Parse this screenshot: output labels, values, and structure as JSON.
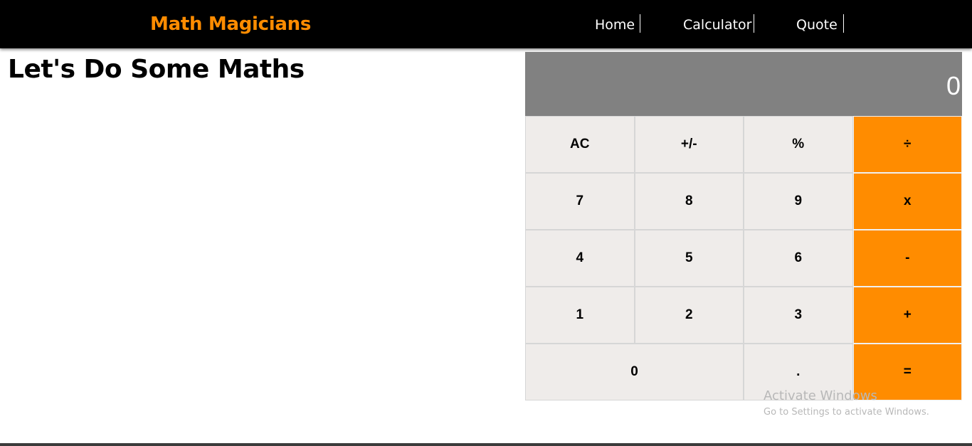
{
  "navbar": {
    "brand": "Math Magicians",
    "links": [
      {
        "label": "Home"
      },
      {
        "label": "Calculator"
      },
      {
        "label": "Quote"
      }
    ]
  },
  "main": {
    "heading": "Let's Do Some Maths"
  },
  "calculator": {
    "display_value": "0",
    "keys": {
      "ac": "AC",
      "sign": "+/-",
      "percent": "%",
      "divide": "÷",
      "seven": "7",
      "eight": "8",
      "nine": "9",
      "multiply": "x",
      "four": "4",
      "five": "5",
      "six": "6",
      "subtract": "-",
      "one": "1",
      "two": "2",
      "three": "3",
      "add": "+",
      "zero": "0",
      "decimal": ".",
      "equals": "="
    }
  },
  "watermark": {
    "title": "Activate Windows",
    "subtitle": "Go to Settings to activate Windows."
  },
  "colors": {
    "accent": "#ff8c00",
    "navbar_bg": "#000000",
    "display_bg": "#818181",
    "key_bg": "#efecea"
  }
}
